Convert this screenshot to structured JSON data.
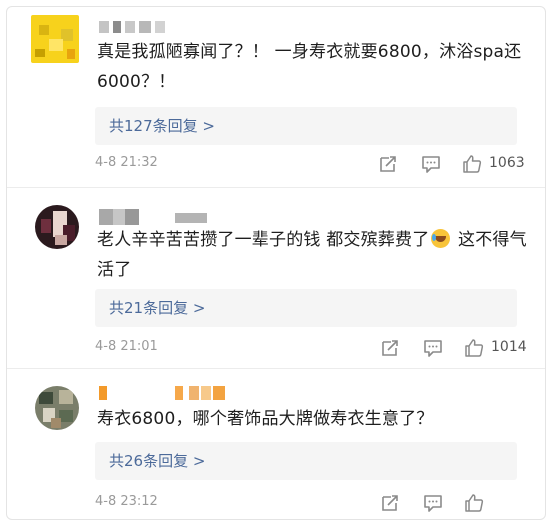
{
  "comments": [
    {
      "text": "真是我孤陋寡闻了？！ 一身寿衣就要6800，沐浴spa还6000？！",
      "replies_label": "共127条回复 >",
      "time": "4-8 21:32",
      "likes": "1063"
    },
    {
      "text_a": "老人辛辛苦苦攒了一辈子的钱  都交殡葬费了",
      "text_b": " 这不得气活了",
      "replies_label": "共21条回复 >",
      "time": "4-8 21:01",
      "likes": "1014"
    },
    {
      "text": "寿衣6800，哪个奢饰品大牌做寿衣生意了？",
      "replies_label": "共26条回复 >",
      "time": "4-8 23:12",
      "likes": ""
    }
  ],
  "icons": {
    "share": "share-icon",
    "comment": "comment-icon",
    "like": "thumbs-up-icon",
    "emoji": "crying-laughing-emoji-icon"
  },
  "colors": {
    "reply_link": "#4c6a9a",
    "reply_bg": "#f5f5f5",
    "meta_text": "#9a9a9a"
  }
}
